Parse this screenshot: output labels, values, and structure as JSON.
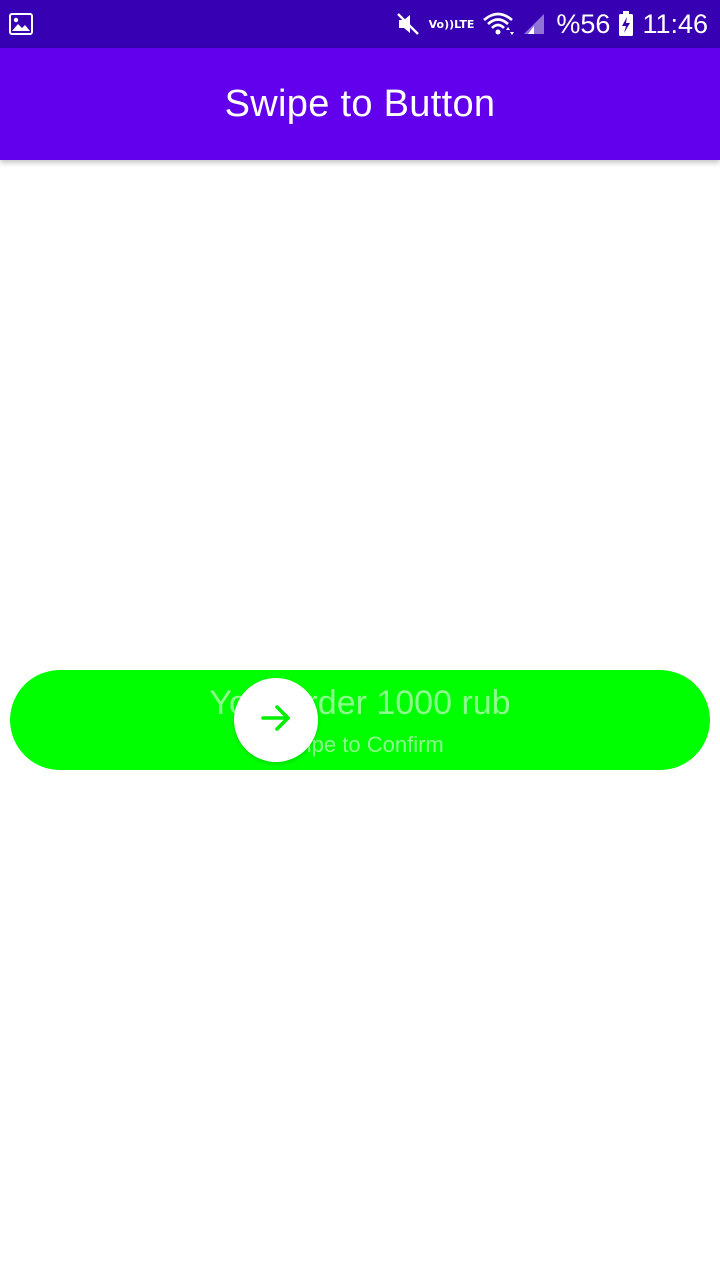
{
  "status_bar": {
    "left_icon": "gallery-notification-icon",
    "icons": [
      "mute-icon",
      "volte-icon",
      "wifi-icon",
      "cell-signal-icon",
      "battery-charging-icon"
    ],
    "volte_top": "Vo))",
    "volte_bottom": "LTE",
    "battery_percent": "%56",
    "time": "11:46",
    "background_color": "#3700b3"
  },
  "app_bar": {
    "title": "Swipe to Button",
    "background_color": "#6200ee"
  },
  "swipe_button": {
    "title": "Your order 1000 rub",
    "subtitle": "Swipe to Confirm",
    "track_color": "#00ff00",
    "thumb_color": "#ffffff",
    "arrow_color": "#00ee00",
    "thumb_icon": "arrow-right-icon"
  }
}
